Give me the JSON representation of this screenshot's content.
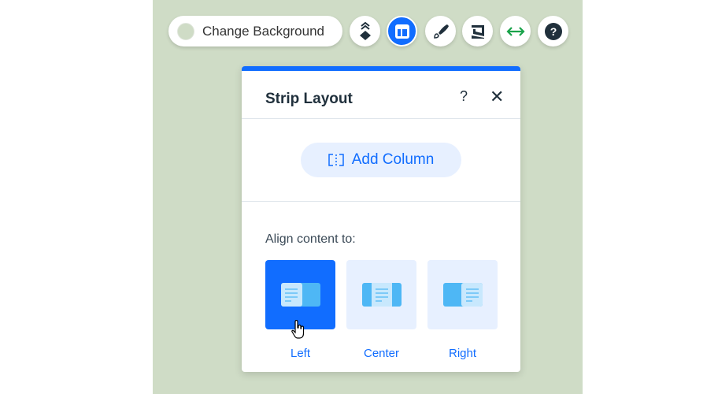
{
  "toolbar": {
    "change_background": "Change Background",
    "buttons": [
      "arrange-icon",
      "layout-icon",
      "paint-brush-icon",
      "animation-icon",
      "stretch-icon",
      "help-icon"
    ],
    "active": "layout-icon"
  },
  "panel": {
    "title": "Strip Layout",
    "help": "?",
    "close": "✕",
    "add_column": "Add Column",
    "align_label": "Align content to:",
    "options": [
      {
        "label": "Left",
        "selected": true
      },
      {
        "label": "Center",
        "selected": false
      },
      {
        "label": "Right",
        "selected": false
      }
    ]
  },
  "colors": {
    "accent": "#116dff",
    "canvas": "#cfdcc6",
    "option_bg": "#e7f0ff"
  }
}
